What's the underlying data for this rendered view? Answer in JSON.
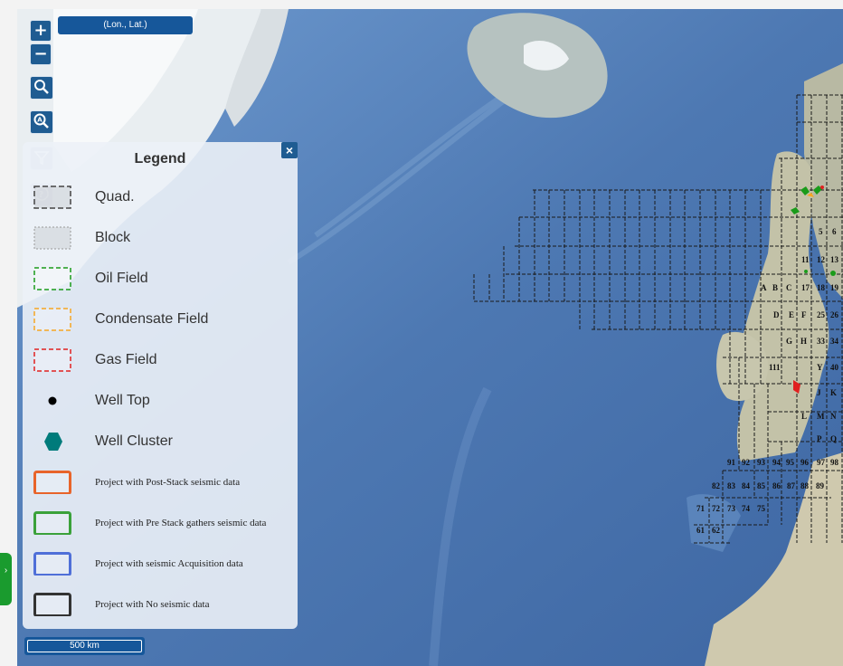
{
  "map": {
    "coord_readout": "(Lon., Lat.)",
    "scale_label": "500 km",
    "controls": [
      {
        "name": "zoom-in-button",
        "glyph": "+"
      },
      {
        "name": "zoom-out-button",
        "glyph": "−"
      },
      {
        "name": "search-button",
        "icon": "magnifier-icon"
      },
      {
        "name": "search-attribute-button",
        "icon": "magnifier-a-icon"
      },
      {
        "name": "filter-button",
        "icon": "funnel-icon"
      },
      {
        "name": "help-button",
        "icon": "question-icon"
      }
    ],
    "colors": {
      "ocean": "#4f79b0",
      "land": "#c9c6b3",
      "ice": "#eef2f4",
      "control": "#1f5c92"
    }
  },
  "legend": {
    "title": "Legend",
    "close_glyph": "×",
    "items": [
      {
        "label": "Quad.",
        "symbol": "dashed-box-dark"
      },
      {
        "label": "Block",
        "symbol": "dotted-box-grey"
      },
      {
        "label": "Oil Field",
        "symbol": "dashed-box-green",
        "color": "#1a9b1a"
      },
      {
        "label": "Condensate Field",
        "symbol": "dashed-box-orange",
        "color": "#f5a623"
      },
      {
        "label": "Gas Field",
        "symbol": "dashed-box-red",
        "color": "#e02020"
      },
      {
        "label": "Well Top",
        "symbol": "dot"
      },
      {
        "label": "Well Cluster",
        "symbol": "hexagon",
        "color": "#007b7b"
      },
      {
        "label": "Project with Post-Stack seismic data",
        "symbol": "solid-box",
        "color": "#e8642a"
      },
      {
        "label": "Project with Pre Stack gathers seismic data",
        "symbol": "solid-box",
        "color": "#3aa13a"
      },
      {
        "label": "Project with seismic Acquisition data",
        "symbol": "solid-box",
        "color": "#4f6fd8"
      },
      {
        "label": "Project with No seismic data",
        "symbol": "solid-box",
        "color": "#333333"
      }
    ]
  },
  "grid_labels": [
    {
      "t": "5"
    },
    {
      "t": "6"
    },
    {
      "t": "11"
    },
    {
      "t": "12"
    },
    {
      "t": "13"
    },
    {
      "t": "A"
    },
    {
      "t": "B"
    },
    {
      "t": "C"
    },
    {
      "t": "17"
    },
    {
      "t": "18"
    },
    {
      "t": "19"
    },
    {
      "t": "D"
    },
    {
      "t": "E"
    },
    {
      "t": "F"
    },
    {
      "t": "25"
    },
    {
      "t": "26"
    },
    {
      "t": "G"
    },
    {
      "t": "H"
    },
    {
      "t": "33"
    },
    {
      "t": "34"
    },
    {
      "t": "111"
    },
    {
      "t": "Y"
    },
    {
      "t": "40"
    },
    {
      "t": "J"
    },
    {
      "t": "K"
    },
    {
      "t": "L"
    },
    {
      "t": "M"
    },
    {
      "t": "N"
    },
    {
      "t": "P"
    },
    {
      "t": "Q"
    },
    {
      "t": "91"
    },
    {
      "t": "92"
    },
    {
      "t": "93"
    },
    {
      "t": "94"
    },
    {
      "t": "95"
    },
    {
      "t": "96"
    },
    {
      "t": "97"
    },
    {
      "t": "98"
    },
    {
      "t": "82"
    },
    {
      "t": "83"
    },
    {
      "t": "84"
    },
    {
      "t": "85"
    },
    {
      "t": "86"
    },
    {
      "t": "87"
    },
    {
      "t": "88"
    },
    {
      "t": "89"
    },
    {
      "t": "71"
    },
    {
      "t": "72"
    },
    {
      "t": "73"
    },
    {
      "t": "74"
    },
    {
      "t": "75"
    },
    {
      "t": "61"
    },
    {
      "t": "62"
    }
  ]
}
